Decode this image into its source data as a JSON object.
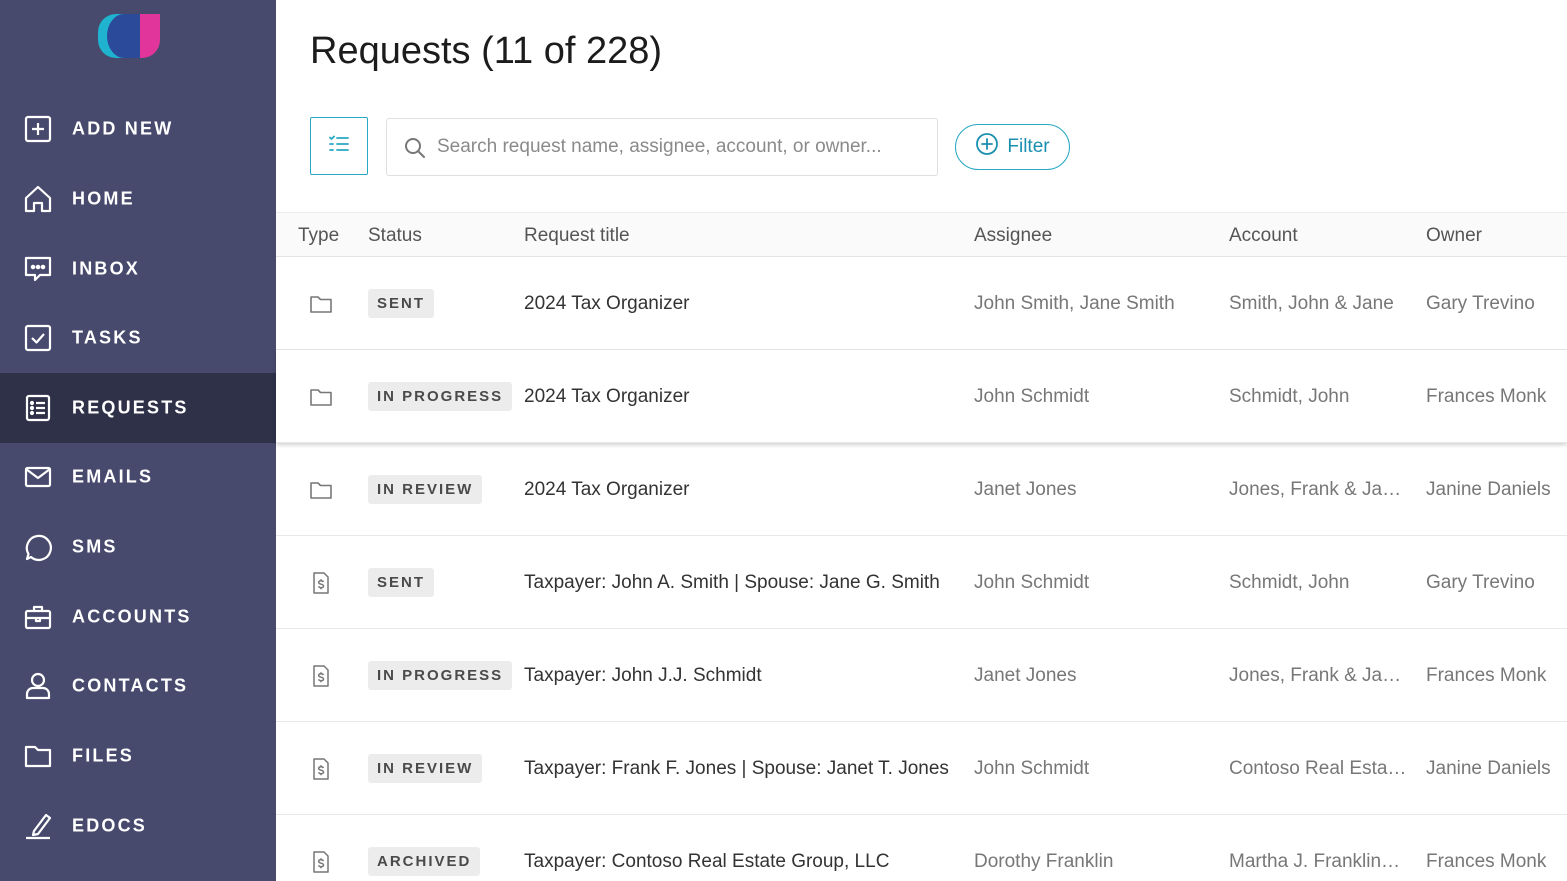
{
  "colors": {
    "sidebar_bg": "#474a6d",
    "sidebar_active": "#2f3149",
    "accent": "#29a8c4",
    "badge_bg": "#ececec"
  },
  "sidebar": {
    "logo": "app-logo",
    "items": [
      {
        "label": "ADD NEW",
        "icon": "plus-square-icon",
        "active": false
      },
      {
        "label": "HOME",
        "icon": "home-icon",
        "active": false
      },
      {
        "label": "INBOX",
        "icon": "inbox-chat-icon",
        "active": false
      },
      {
        "label": "TASKS",
        "icon": "check-square-icon",
        "active": false
      },
      {
        "label": "REQUESTS",
        "icon": "list-doc-icon",
        "active": true
      },
      {
        "label": "EMAILS",
        "icon": "envelope-icon",
        "active": false
      },
      {
        "label": "SMS",
        "icon": "speech-bubble-icon",
        "active": false
      },
      {
        "label": "ACCOUNTS",
        "icon": "briefcase-icon",
        "active": false
      },
      {
        "label": "CONTACTS",
        "icon": "person-icon",
        "active": false
      },
      {
        "label": "FILES",
        "icon": "folder-icon",
        "active": false
      },
      {
        "label": "EDOCS",
        "icon": "signature-pen-icon",
        "active": false
      }
    ]
  },
  "main": {
    "title": "Requests (11 of 228)",
    "search": {
      "placeholder": "Search request name, assignee, account, or owner...",
      "value": ""
    },
    "filter_label": "Filter",
    "columns": [
      "Type",
      "Status",
      "Request title",
      "Assignee",
      "Account",
      "Owner"
    ],
    "rows": [
      {
        "type": "folder-icon",
        "status": "SENT",
        "title": "2024 Tax Organizer",
        "assignee": "John Smith, Jane Smith",
        "account": "Smith, John & Jane",
        "owner": "Gary Trevino"
      },
      {
        "type": "folder-icon",
        "status": "IN PROGRESS",
        "title": "2024 Tax Organizer",
        "assignee": "John Schmidt",
        "account": "Schmidt, John",
        "owner": "Frances Monk"
      },
      {
        "type": "folder-icon",
        "status": "IN REVIEW",
        "title": "2024 Tax Organizer",
        "assignee": "Janet Jones",
        "account": "Jones, Frank & Ja…",
        "owner": "Janine Daniels"
      },
      {
        "type": "dollar-doc-icon",
        "status": "SENT",
        "title": "Taxpayer: John A. Smith | Spouse: Jane G. Smith",
        "assignee": "John Schmidt",
        "account": "Schmidt, John",
        "owner": "Gary Trevino"
      },
      {
        "type": "dollar-doc-icon",
        "status": "IN PROGRESS",
        "title": "Taxpayer: John J.J. Schmidt",
        "assignee": "Janet Jones",
        "account": "Jones, Frank & Ja…",
        "owner": "Frances Monk"
      },
      {
        "type": "dollar-doc-icon",
        "status": "IN REVIEW",
        "title": "Taxpayer: Frank F. Jones | Spouse: Janet T. Jones",
        "assignee": "John Schmidt",
        "account": "Contoso Real Esta…",
        "owner": "Janine Daniels"
      },
      {
        "type": "dollar-doc-icon",
        "status": "ARCHIVED",
        "title": "Taxpayer: Contoso Real Estate Group, LLC",
        "assignee": "Dorothy Franklin",
        "account": "Martha J. Franklin…",
        "owner": "Frances Monk"
      }
    ]
  }
}
